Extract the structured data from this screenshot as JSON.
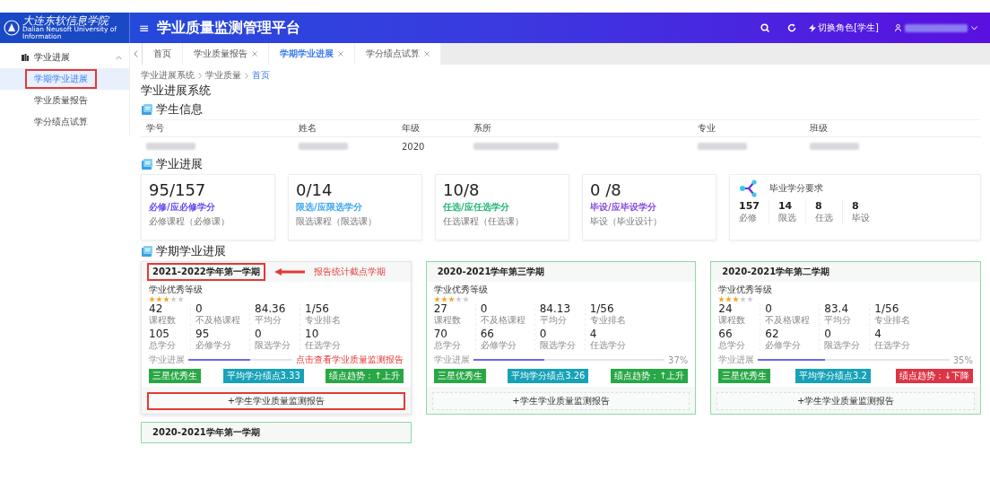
{
  "header": {
    "logo_text": "大连东软信息学院",
    "logo_subtitle": "Dalian Neusoft University of Information",
    "menu_glyph": "≡",
    "title": "学业质量监测管理平台",
    "role_switch": "切换角色[学生]"
  },
  "sidebar": {
    "group": {
      "label": "学业进展",
      "expanded": true
    },
    "items": [
      {
        "label": "学期学业进展",
        "selected": true,
        "annotated": true
      },
      {
        "label": "学业质量报告",
        "selected": false,
        "annotated": false
      },
      {
        "label": "学分绩点试算",
        "selected": false,
        "annotated": false
      }
    ]
  },
  "tabs": [
    {
      "label": "首页",
      "selected": false,
      "closable": false
    },
    {
      "label": "学业质量报告",
      "selected": false,
      "closable": true
    },
    {
      "label": "学期学业进展",
      "selected": true,
      "closable": true
    },
    {
      "label": "学分绩点试算",
      "selected": false,
      "closable": true
    }
  ],
  "breadcrumb": [
    "学业进展系统",
    "学业质量",
    "首页"
  ],
  "page_title": "学业进展系统",
  "student_info": {
    "title": "学生信息",
    "columns": [
      "学号",
      "姓名",
      "年级",
      "系所",
      "专业",
      "班级"
    ],
    "values": [
      {
        "kind": "redacted"
      },
      {
        "kind": "redacted"
      },
      {
        "kind": "text",
        "text": "2020"
      },
      {
        "kind": "redacted"
      },
      {
        "kind": "redacted"
      },
      {
        "kind": "redacted"
      }
    ]
  },
  "progress": {
    "title": "学业进展",
    "cards": [
      {
        "value": "95/157",
        "label": "必修/应必修学分",
        "sublabel": "必修课程（必修课）",
        "color": "#6a4cf0"
      },
      {
        "value": "0/14",
        "label": "限选/应限选学分",
        "sublabel": "限选课程（限选课）",
        "color": "#3ea6f0"
      },
      {
        "value": "10/8",
        "label": "任选/应任选学分",
        "sublabel": "任选课程（任选课）",
        "color": "#22b573"
      },
      {
        "value": "0 /8",
        "label": "毕设/应毕设学分",
        "sublabel": "毕设（毕业设计）",
        "color": "#8a4ce0"
      }
    ],
    "requirement": {
      "title": "毕业学分要求",
      "items": [
        {
          "value": "157",
          "label": "必修"
        },
        {
          "value": "14",
          "label": "限选"
        },
        {
          "value": "8",
          "label": "任选"
        },
        {
          "value": "8",
          "label": "毕设"
        }
      ]
    }
  },
  "semesters": {
    "title": "学期学业进展",
    "cards": [
      {
        "title": "2021-2022学年第一学期",
        "current": true,
        "title_note": "报告统计截点学期",
        "grade_label": "学业优秀等级",
        "stars": 3,
        "stats": [
          [
            {
              "value": "42",
              "label": "课程数"
            },
            {
              "value": "0",
              "label": "不及格课程"
            },
            {
              "value": "84.36",
              "label": "平均分"
            },
            {
              "value": "1/56",
              "label": "专业排名"
            }
          ],
          [
            {
              "value": "105",
              "label": "总学分"
            },
            {
              "value": "95",
              "label": "必修学分"
            },
            {
              "value": "0",
              "label": "限选学分"
            },
            {
              "value": "10",
              "label": "任选学分"
            }
          ]
        ],
        "progress_label": "学业进展",
        "level": 0.6,
        "button_note": "点击查看学业质量监测报告",
        "badges": [
          {
            "text": "三星优秀生",
            "color": "#28a745"
          },
          {
            "text": "平均学分绩点3.33",
            "color": "#17a2b8"
          },
          {
            "text": "绩点趋势：↑上升",
            "color": "#28a745"
          }
        ],
        "report_button": "+学生学业质量监测报告"
      },
      {
        "title": "2020-2021学年第三学期",
        "current": false,
        "grade_label": "学业优秀等级",
        "stars": 3,
        "stats": [
          [
            {
              "value": "27",
              "label": "课程数"
            },
            {
              "value": "0",
              "label": "不及格课程"
            },
            {
              "value": "84.13",
              "label": "平均分"
            },
            {
              "value": "1/56",
              "label": "专业排名"
            }
          ],
          [
            {
              "value": "70",
              "label": "总学分"
            },
            {
              "value": "66",
              "label": "必修学分"
            },
            {
              "value": "0",
              "label": "限选学分"
            },
            {
              "value": "4",
              "label": "任选学分"
            }
          ]
        ],
        "progress_label": "学业进展",
        "level": 0.37,
        "reading": "37%",
        "badges": [
          {
            "text": "三星优秀生",
            "color": "#28a745"
          },
          {
            "text": "平均学分绩点3.26",
            "color": "#17a2b8"
          },
          {
            "text": "绩点趋势：↑上升",
            "color": "#28a745"
          }
        ],
        "report_button": "+学生学业质量监测报告"
      },
      {
        "title": "2020-2021学年第二学期",
        "current": false,
        "grade_label": "学业优秀等级",
        "stars": 3,
        "stats": [
          [
            {
              "value": "24",
              "label": "课程数"
            },
            {
              "value": "0",
              "label": "不及格课程"
            },
            {
              "value": "83.4",
              "label": "平均分"
            },
            {
              "value": "1/56",
              "label": "专业排名"
            }
          ],
          [
            {
              "value": "66",
              "label": "总学分"
            },
            {
              "value": "62",
              "label": "必修学分"
            },
            {
              "value": "0",
              "label": "限选学分"
            },
            {
              "value": "4",
              "label": "任选学分"
            }
          ]
        ],
        "progress_label": "学业进展",
        "level": 0.35,
        "reading": "35%",
        "badges": [
          {
            "text": "三星优秀生",
            "color": "#28a745"
          },
          {
            "text": "平均学分绩点3.2",
            "color": "#17a2b8"
          },
          {
            "text": "绩点趋势：↓下降",
            "color": "#dc3545"
          }
        ],
        "report_button": "+学生学业质量监测报告"
      },
      {
        "title": "2020-2021学年第一学期",
        "current": false
      }
    ]
  }
}
